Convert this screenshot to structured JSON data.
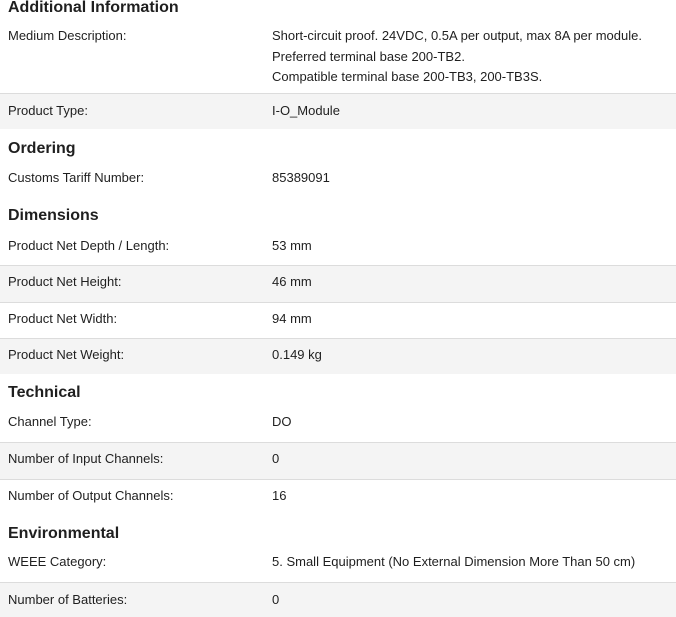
{
  "additional_information": {
    "title": "Additional Information",
    "medium_description": {
      "label": "Medium Description:",
      "lines": [
        "Short-circuit proof. 24VDC, 0.5A per output, max 8A per module.",
        "Preferred terminal base 200-TB2.",
        "Compatible terminal base 200-TB3, 200-TB3S."
      ]
    },
    "product_type": {
      "label": "Product Type:",
      "value": "I-O_Module"
    }
  },
  "ordering": {
    "title": "Ordering",
    "customs_tariff": {
      "label": "Customs Tariff Number:",
      "value": "85389091"
    }
  },
  "dimensions": {
    "title": "Dimensions",
    "rows": [
      {
        "label": "Product Net Depth / Length:",
        "value": "53 mm"
      },
      {
        "label": "Product Net Height:",
        "value": "46 mm"
      },
      {
        "label": "Product Net Width:",
        "value": "94 mm"
      },
      {
        "label": "Product Net Weight:",
        "value": "0.149 kg"
      }
    ]
  },
  "technical": {
    "title": "Technical",
    "rows": [
      {
        "label": "Channel Type:",
        "value": "DO"
      },
      {
        "label": "Number of Input Channels:",
        "value": "0"
      },
      {
        "label": "Number of Output Channels:",
        "value": "16"
      }
    ]
  },
  "environmental": {
    "title": "Environmental",
    "rows": [
      {
        "label": "WEEE Category:",
        "value": "5. Small Equipment (No External Dimension More Than 50 cm)"
      },
      {
        "label": "Number of Batteries:",
        "value": "0"
      }
    ]
  }
}
